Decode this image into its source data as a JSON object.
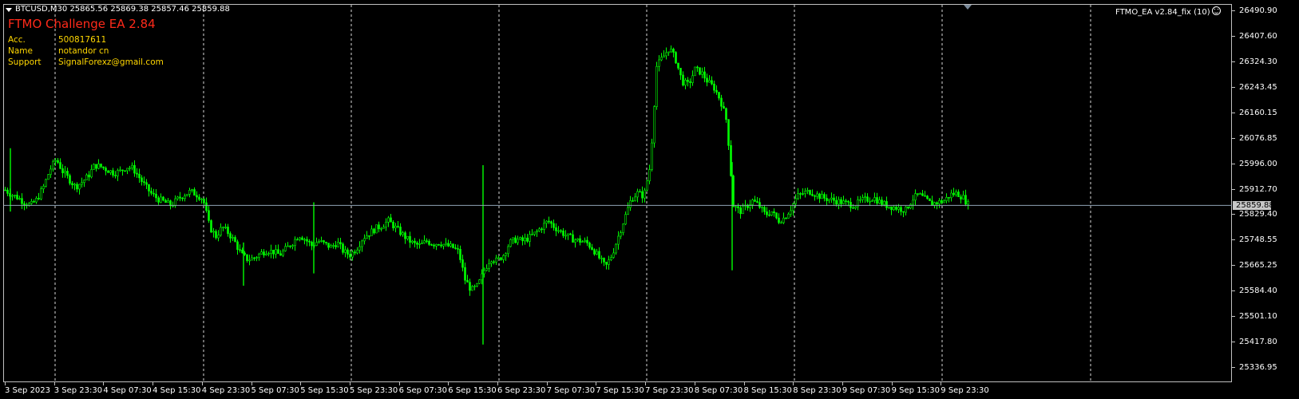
{
  "window": {
    "symbol_header": "BTCUSD,M30  25865.56 25869.38 25857.46 25859.88",
    "indicator_label": "FTMO_EA  v2.84_fix (10)"
  },
  "ea_panel": {
    "title": "FTMO Challenge EA 2.84",
    "rows": [
      {
        "key": "Acc.",
        "value": "500817611"
      },
      {
        "key": "Name",
        "value": "notandor cn"
      },
      {
        "key": "Support",
        "value": "SignalForexz@gmail.com"
      }
    ]
  },
  "colors": {
    "background": "#000000",
    "candle": "#00ff00",
    "frame": "#c0c0c0",
    "grid": "#ffffff",
    "price_line": "#8fa3b5",
    "title": "#ff2a1a",
    "info": "#ffd700"
  },
  "price_axis": {
    "labels": [
      "26490.90",
      "26407.60",
      "26324.30",
      "26243.45",
      "26160.15",
      "26076.85",
      "25996.00",
      "25912.70",
      "25829.40",
      "25748.55",
      "25665.25",
      "25584.40",
      "25501.10",
      "25417.80",
      "25336.95"
    ],
    "current_price": "25859.88"
  },
  "time_axis": {
    "labels": [
      "3 Sep 2023",
      "3 Sep 23:30",
      "4 Sep 07:30",
      "4 Sep 15:30",
      "4 Sep 23:30",
      "5 Sep 07:30",
      "5 Sep 15:30",
      "5 Sep 23:30",
      "6 Sep 07:30",
      "6 Sep 15:30",
      "6 Sep 23:30",
      "7 Sep 07:30",
      "7 Sep 15:30",
      "7 Sep 23:30",
      "8 Sep 07:30",
      "8 Sep 15:30",
      "8 Sep 23:30",
      "9 Sep 07:30",
      "9 Sep 15:30",
      "9 Sep 23:30"
    ]
  },
  "chart_data": {
    "type": "candlestick",
    "symbol": "BTCUSD",
    "timeframe": "M30",
    "ylim": [
      25336.95,
      26490.9
    ],
    "last": {
      "open": 25865.56,
      "high": 25869.38,
      "low": 25857.46,
      "close": 25859.88
    },
    "close_path": [
      [
        0,
        25910
      ],
      [
        8,
        25895
      ],
      [
        16,
        25885
      ],
      [
        24,
        25870
      ],
      [
        32,
        25860
      ],
      [
        40,
        25880
      ],
      [
        48,
        25920
      ],
      [
        56,
        25975
      ],
      [
        64,
        26010
      ],
      [
        72,
        25970
      ],
      [
        80,
        25945
      ],
      [
        88,
        25920
      ],
      [
        96,
        25935
      ],
      [
        104,
        25955
      ],
      [
        112,
        25990
      ],
      [
        120,
        25985
      ],
      [
        128,
        25975
      ],
      [
        136,
        25965
      ],
      [
        144,
        25970
      ],
      [
        152,
        25985
      ],
      [
        160,
        25980
      ],
      [
        168,
        25950
      ],
      [
        176,
        25920
      ],
      [
        184,
        25895
      ],
      [
        192,
        25880
      ],
      [
        200,
        25870
      ],
      [
        208,
        25860
      ],
      [
        216,
        25880
      ],
      [
        224,
        25895
      ],
      [
        232,
        25905
      ],
      [
        240,
        25895
      ],
      [
        248,
        25880
      ],
      [
        256,
        25790
      ],
      [
        264,
        25760
      ],
      [
        272,
        25790
      ],
      [
        280,
        25770
      ],
      [
        288,
        25740
      ],
      [
        296,
        25700
      ],
      [
        304,
        25685
      ],
      [
        312,
        25690
      ],
      [
        320,
        25705
      ],
      [
        328,
        25715
      ],
      [
        336,
        25710
      ],
      [
        344,
        25700
      ],
      [
        352,
        25720
      ],
      [
        360,
        25740
      ],
      [
        368,
        25765
      ],
      [
        376,
        25750
      ],
      [
        384,
        25730
      ],
      [
        392,
        25745
      ],
      [
        400,
        25735
      ],
      [
        408,
        25725
      ],
      [
        416,
        25740
      ],
      [
        424,
        25710
      ],
      [
        432,
        25700
      ],
      [
        440,
        25720
      ],
      [
        448,
        25755
      ],
      [
        456,
        25770
      ],
      [
        464,
        25785
      ],
      [
        472,
        25795
      ],
      [
        480,
        25810
      ],
      [
        488,
        25790
      ],
      [
        496,
        25770
      ],
      [
        504,
        25750
      ],
      [
        512,
        25735
      ],
      [
        520,
        25730
      ],
      [
        528,
        25745
      ],
      [
        536,
        25735
      ],
      [
        544,
        25740
      ],
      [
        552,
        25730
      ],
      [
        560,
        25725
      ],
      [
        568,
        25710
      ],
      [
        576,
        25620
      ],
      [
        584,
        25585
      ],
      [
        592,
        25600
      ],
      [
        600,
        25650
      ],
      [
        608,
        25690
      ],
      [
        616,
        25680
      ],
      [
        624,
        25700
      ],
      [
        632,
        25740
      ],
      [
        640,
        25750
      ],
      [
        648,
        25745
      ],
      [
        656,
        25755
      ],
      [
        664,
        25770
      ],
      [
        672,
        25790
      ],
      [
        680,
        25810
      ],
      [
        688,
        25790
      ],
      [
        696,
        25775
      ],
      [
        704,
        25760
      ],
      [
        712,
        25750
      ],
      [
        720,
        25745
      ],
      [
        728,
        25740
      ],
      [
        736,
        25720
      ],
      [
        744,
        25690
      ],
      [
        752,
        25660
      ],
      [
        760,
        25700
      ],
      [
        768,
        25760
      ],
      [
        776,
        25820
      ],
      [
        784,
        25880
      ],
      [
        792,
        25900
      ],
      [
        800,
        25890
      ],
      [
        808,
        25990
      ],
      [
        816,
        26310
      ],
      [
        824,
        26340
      ],
      [
        832,
        26370
      ],
      [
        840,
        26330
      ],
      [
        848,
        26260
      ],
      [
        856,
        26250
      ],
      [
        864,
        26300
      ],
      [
        872,
        26290
      ],
      [
        880,
        26260
      ],
      [
        888,
        26240
      ],
      [
        896,
        26200
      ],
      [
        904,
        26130
      ],
      [
        912,
        25860
      ],
      [
        920,
        25840
      ],
      [
        928,
        25855
      ],
      [
        936,
        25875
      ],
      [
        944,
        25860
      ],
      [
        952,
        25830
      ],
      [
        960,
        25840
      ],
      [
        968,
        25810
      ],
      [
        976,
        25820
      ],
      [
        984,
        25850
      ],
      [
        992,
        25890
      ],
      [
        1000,
        25900
      ],
      [
        1008,
        25905
      ],
      [
        1016,
        25895
      ],
      [
        1024,
        25885
      ],
      [
        1032,
        25880
      ],
      [
        1040,
        25875
      ],
      [
        1048,
        25870
      ],
      [
        1056,
        25865
      ],
      [
        1064,
        25860
      ],
      [
        1072,
        25875
      ],
      [
        1080,
        25880
      ],
      [
        1088,
        25885
      ],
      [
        1096,
        25870
      ],
      [
        1104,
        25860
      ],
      [
        1112,
        25855
      ],
      [
        1120,
        25850
      ],
      [
        1128,
        25845
      ],
      [
        1136,
        25880
      ],
      [
        1144,
        25895
      ],
      [
        1152,
        25880
      ],
      [
        1160,
        25865
      ],
      [
        1168,
        25870
      ],
      [
        1176,
        25875
      ],
      [
        1184,
        25895
      ],
      [
        1192,
        25900
      ],
      [
        1200,
        25885
      ],
      [
        1207,
        25860
      ]
    ],
    "spikes": [
      {
        "x": 600,
        "high": 25990,
        "low": 25410
      },
      {
        "x": 912,
        "high": 26000,
        "low": 25650
      },
      {
        "x": 8,
        "high": 26045,
        "low": 25840
      },
      {
        "x": 388,
        "high": 25870,
        "low": 25640
      },
      {
        "x": 300,
        "high": 25740,
        "low": 25600
      }
    ],
    "vertical_grid_at": [
      "3 Sep 23:30",
      "4 Sep 23:30",
      "5 Sep 23:30",
      "6 Sep 23:30",
      "7 Sep 23:30",
      "8 Sep 23:30",
      "9 Sep 23:30"
    ],
    "grid": "dashed vertical day separators"
  }
}
